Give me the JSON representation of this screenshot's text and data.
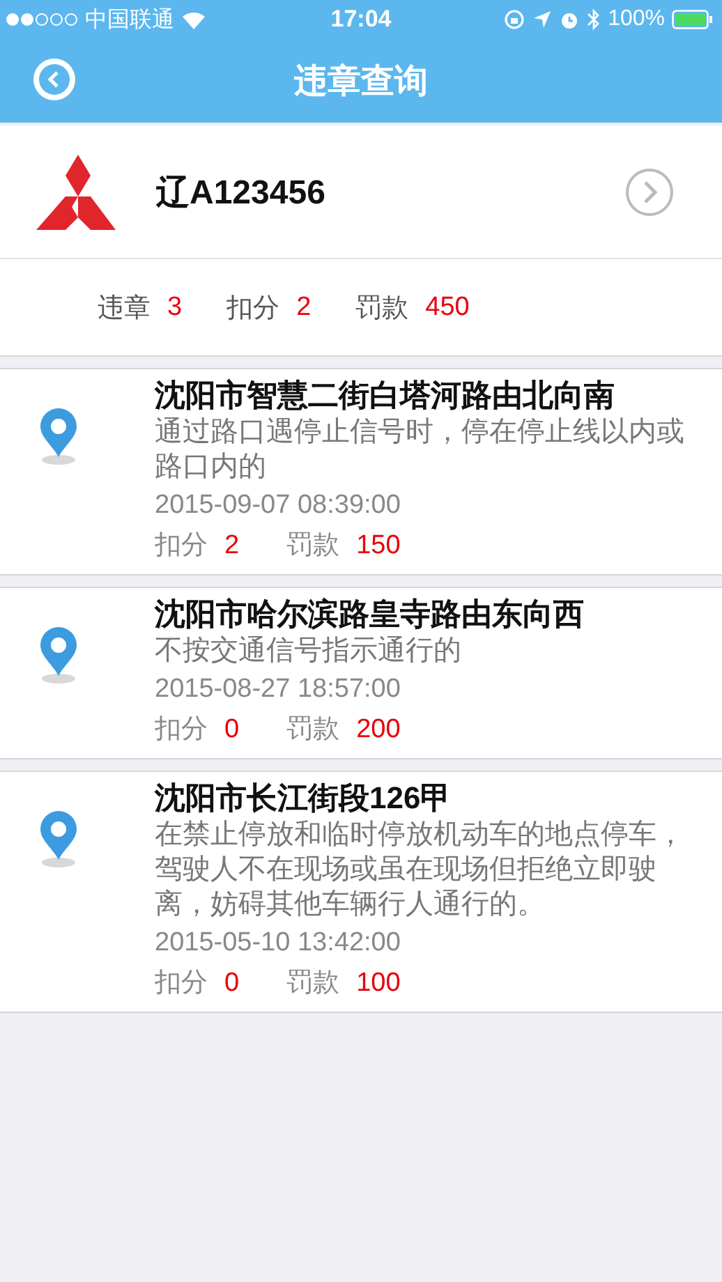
{
  "status_bar": {
    "carrier": "中国联通",
    "time": "17:04",
    "battery": "100%"
  },
  "nav": {
    "title": "违章查询"
  },
  "car": {
    "plate": "辽A123456"
  },
  "summary": [
    {
      "label": "违章",
      "value": "3"
    },
    {
      "label": "扣分",
      "value": "2"
    },
    {
      "label": "罚款",
      "value": "450"
    }
  ],
  "records": [
    {
      "location": "沈阳市智慧二街白塔河路由北向南",
      "description": "通过路口遇停止信号时，停在停止线以内或路口内的",
      "time": "2015-09-07 08:39:00",
      "points_label": "扣分",
      "points": "2",
      "fine_label": "罚款",
      "fine": "150"
    },
    {
      "location": "沈阳市哈尔滨路皇寺路由东向西",
      "description": "不按交通信号指示通行的",
      "time": "2015-08-27 18:57:00",
      "points_label": "扣分",
      "points": "0",
      "fine_label": "罚款",
      "fine": "200"
    },
    {
      "location": "沈阳市长江街段126甲",
      "description": "在禁止停放和临时停放机动车的地点停车，驾驶人不在现场或虽在现场但拒绝立即驶离，妨碍其他车辆行人通行的。",
      "time": "2015-05-10 13:42:00",
      "points_label": "扣分",
      "points": "0",
      "fine_label": "罚款",
      "fine": "100"
    }
  ]
}
